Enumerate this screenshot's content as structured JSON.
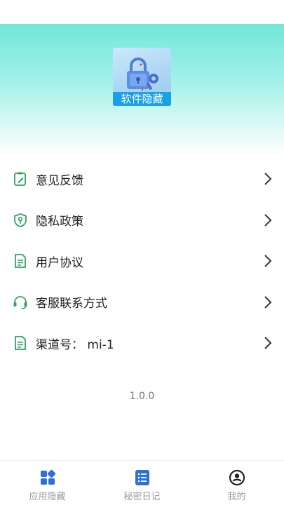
{
  "app": {
    "icon_label": "软件隐藏"
  },
  "menu": {
    "items": [
      {
        "label": "意见反馈",
        "icon": "feedback-icon"
      },
      {
        "label": "隐私政策",
        "icon": "privacy-shield-icon"
      },
      {
        "label": "用户协议",
        "icon": "document-icon"
      },
      {
        "label": "客服联系方式",
        "icon": "headset-icon"
      },
      {
        "label": "渠道号： mi-1",
        "icon": "document-icon"
      }
    ]
  },
  "version": "1.0.0",
  "tabbar": {
    "tabs": [
      {
        "label": "应用隐藏",
        "icon": "apps-grid-icon"
      },
      {
        "label": "秘密日记",
        "icon": "list-icon"
      },
      {
        "label": "我的",
        "icon": "profile-icon"
      }
    ]
  },
  "colors": {
    "accent_green": "#2fa560",
    "header_gradient_top": "#6fe7da",
    "tab_icon_blue": "#2f6fdc",
    "icon_label_blue": "#18a0ea"
  }
}
